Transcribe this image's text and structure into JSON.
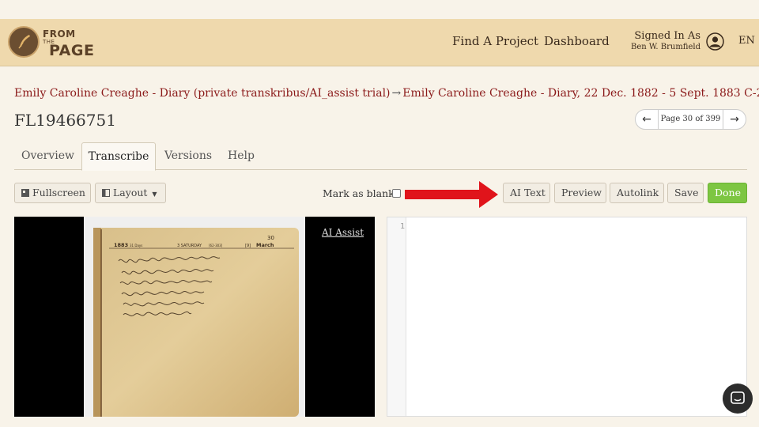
{
  "header": {
    "logo": {
      "line1": "FROM",
      "line2": "THE",
      "line3": "PAGE"
    },
    "nav": {
      "find_project": "Find A Project",
      "dashboard": "Dashboard"
    },
    "user": {
      "signed_in_as": "Signed In As",
      "name": "Ben W. Brumfield"
    },
    "language": "EN"
  },
  "breadcrumb": {
    "collection": "Emily Caroline Creaghe - Diary (private transkribus/AI_assist trial)",
    "separator": "→",
    "work": "Emily Caroline Creaghe - Diary, 22 Dec. 1882 - 5 Sept. 1883 C-2"
  },
  "page": {
    "title": "FL19466751"
  },
  "pager": {
    "prev": "←",
    "label": "Page 30 of 399",
    "next": "→"
  },
  "tabs": [
    {
      "label": "Overview",
      "active": false
    },
    {
      "label": "Transcribe",
      "active": true
    },
    {
      "label": "Versions",
      "active": false
    },
    {
      "label": "Help",
      "active": false
    }
  ],
  "toolbar": {
    "fullscreen": "Fullscreen",
    "layout": "Layout",
    "mark_as_blank": "Mark as blank",
    "mark_as_blank_checked": false,
    "ai_text": "AI Text",
    "preview": "Preview",
    "autolink": "Autolink",
    "save": "Save",
    "done": "Done"
  },
  "image_viewer": {
    "ai_assist_link": "AI Assist",
    "diary_header": {
      "year": "1883",
      "days": "31 Days",
      "weekday": "3 SATURDAY",
      "yearday": "[62-303]",
      "week": "[9]",
      "month": "March",
      "day": "30"
    }
  },
  "editor": {
    "line_number": "1",
    "content": ""
  },
  "colors": {
    "header_bg": "#efd9ad",
    "page_bg": "#f8f3e9",
    "link": "#8b1a1a",
    "done_button": "#7dc642",
    "annotation_arrow": "#e0141b"
  },
  "icons": {
    "logo": "quill-pen-icon",
    "user": "user-circle-icon",
    "fullscreen": "fullscreen-icon",
    "layout": "layout-icon",
    "chat": "chat-bubble-icon"
  }
}
